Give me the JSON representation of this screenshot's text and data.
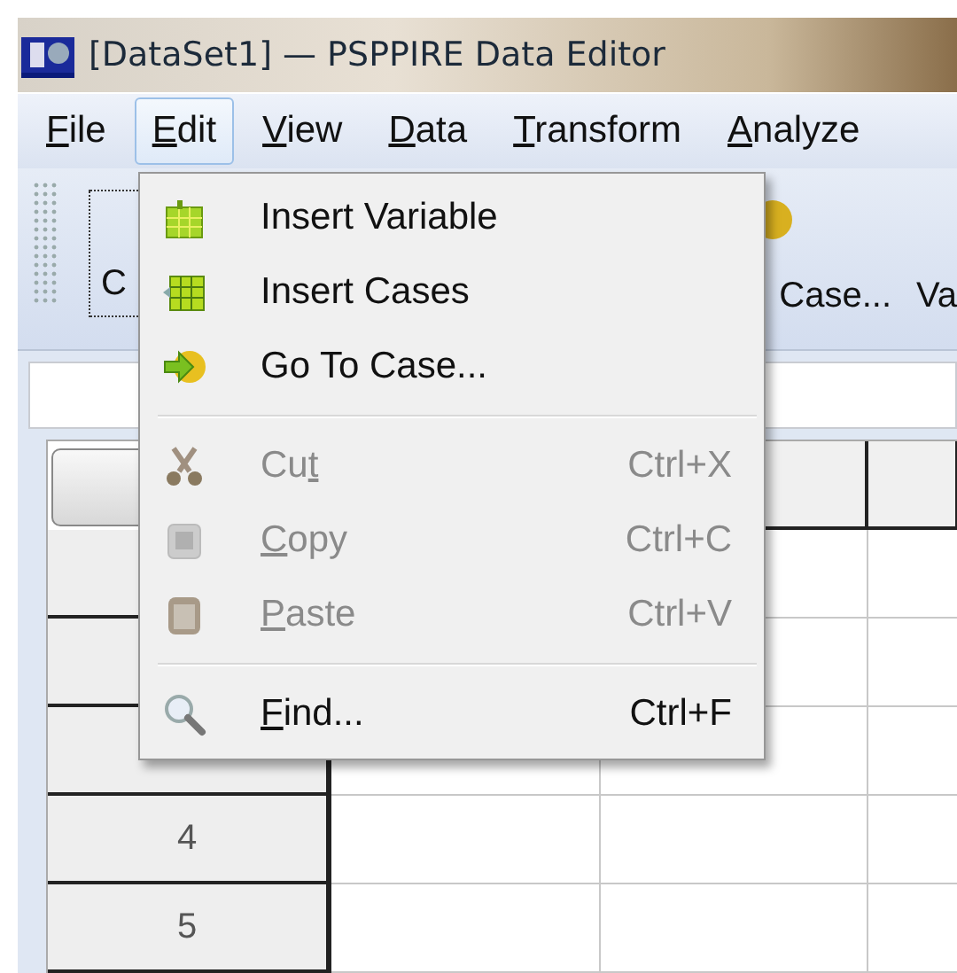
{
  "window": {
    "title": "[DataSet1] — PSPPIRE Data Editor"
  },
  "menu_bar": [
    {
      "key": "F",
      "post": "ile",
      "selected": false
    },
    {
      "key": "E",
      "post": "dit",
      "selected": true
    },
    {
      "key": "V",
      "post": "iew",
      "selected": false
    },
    {
      "key": "D",
      "post": "ata",
      "selected": false
    },
    {
      "key": "T",
      "post": "ransform",
      "selected": false
    },
    {
      "key": "A",
      "post": "nalyze",
      "selected": false
    }
  ],
  "toolbar": {
    "items": [
      "C",
      "Case...",
      "Va"
    ]
  },
  "edit_menu": {
    "items": [
      {
        "kind": "item",
        "pre": "Insert Variable",
        "disabled": false
      },
      {
        "kind": "item",
        "pre": "Insert Cases",
        "disabled": false
      },
      {
        "kind": "item",
        "pre": "Go To Case...",
        "disabled": false
      },
      {
        "kind": "separator"
      },
      {
        "kind": "item",
        "pre": "Cu",
        "key": "t",
        "shortcut": "Ctrl+X",
        "disabled": true
      },
      {
        "kind": "item",
        "key": "C",
        "post": "opy",
        "shortcut": "Ctrl+C",
        "disabled": true
      },
      {
        "kind": "item",
        "key": "P",
        "post": "aste",
        "shortcut": "Ctrl+V",
        "disabled": true
      },
      {
        "kind": "separator"
      },
      {
        "kind": "item",
        "key": "F",
        "post": "ind...",
        "shortcut": "Ctrl+F",
        "disabled": false
      }
    ]
  },
  "grid": {
    "row_headers": [
      "4",
      "5"
    ]
  }
}
